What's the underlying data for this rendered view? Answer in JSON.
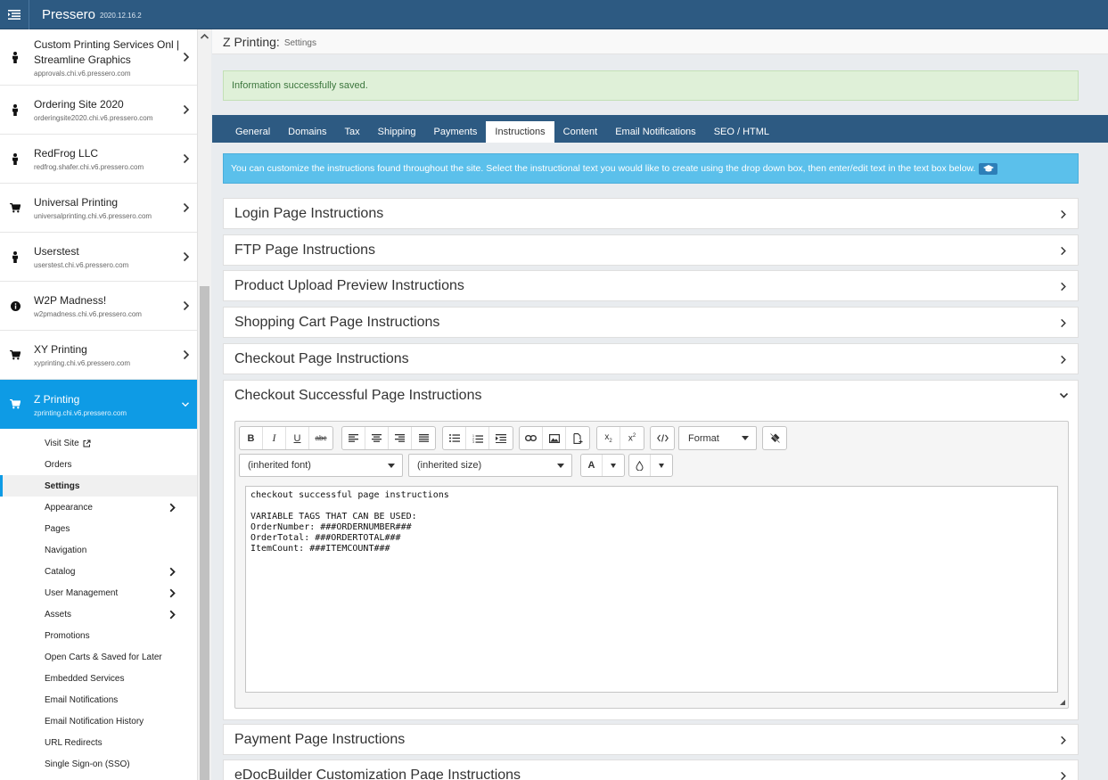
{
  "topbar": {
    "title": "Pressero",
    "version": "2020.12.16.2"
  },
  "sites": [
    {
      "icon": "person-icon",
      "name": "Custom Printing Services Onl | Streamline Graphics",
      "url": "approvals.chi.v6.pressero.com"
    },
    {
      "icon": "person-icon",
      "name": "Ordering Site 2020",
      "url": "orderingsite2020.chi.v6.pressero.com"
    },
    {
      "icon": "person-icon",
      "name": "RedFrog LLC",
      "url": "redfrog.shafer.chi.v6.pressero.com"
    },
    {
      "icon": "cart-icon",
      "name": "Universal Printing",
      "url": "universalprinting.chi.v6.pressero.com"
    },
    {
      "icon": "person-icon",
      "name": "Userstest",
      "url": "userstest.chi.v6.pressero.com"
    },
    {
      "icon": "info-icon",
      "name": "W2P Madness!",
      "url": "w2pmadness.chi.v6.pressero.com"
    },
    {
      "icon": "cart-icon",
      "name": "XY Printing",
      "url": "xyprinting.chi.v6.pressero.com"
    },
    {
      "icon": "cart-icon",
      "name": "Z Printing",
      "url": "zprinting.chi.v6.pressero.com"
    }
  ],
  "subnav": [
    {
      "label": "Visit Site",
      "ext": true
    },
    {
      "label": "Orders"
    },
    {
      "label": "Settings",
      "active": true
    },
    {
      "label": "Appearance",
      "chevron": true
    },
    {
      "label": "Pages"
    },
    {
      "label": "Navigation"
    },
    {
      "label": "Catalog",
      "chevron": true
    },
    {
      "label": "User Management",
      "chevron": true
    },
    {
      "label": "Assets",
      "chevron": true
    },
    {
      "label": "Promotions"
    },
    {
      "label": "Open Carts & Saved for Later"
    },
    {
      "label": "Embedded Services"
    },
    {
      "label": "Email Notifications"
    },
    {
      "label": "Email Notification History"
    },
    {
      "label": "URL Redirects"
    },
    {
      "label": "Single Sign-on (SSO)"
    }
  ],
  "header": {
    "title": "Z Printing:",
    "subtitle": "Settings"
  },
  "alerts": {
    "success": "Information successfully saved.",
    "info": "You can customize the instructions found throughout the site. Select the instructional text you would like to create using the drop down box, then enter/edit text in the text box below."
  },
  "tabs": [
    "General",
    "Domains",
    "Tax",
    "Shipping",
    "Payments",
    "Instructions",
    "Content",
    "Email Notifications",
    "SEO / HTML"
  ],
  "active_tab": "Instructions",
  "panels": [
    "Login Page Instructions",
    "FTP Page Instructions",
    "Product Upload Preview Instructions",
    "Shopping Cart Page Instructions",
    "Checkout Page Instructions",
    "Checkout Successful Page Instructions",
    "Payment Page Instructions",
    "eDocBuilder Customization Page Instructions"
  ],
  "editor": {
    "format_label": "Format",
    "font_select": "(inherited font)",
    "size_select": "(inherited size)",
    "text_color_label": "A",
    "content": [
      "checkout successful page instructions",
      "",
      "VARIABLE TAGS THAT CAN BE USED:",
      "OrderNumber: ###ORDERNUMBER###",
      "OrderTotal: ###ORDERTOTAL###",
      "ItemCount: ###ITEMCOUNT###"
    ]
  },
  "colors": {
    "nav_bar": "#2d5a82",
    "active_site": "#0e9be5",
    "success_bg": "#dff0d8",
    "info_bg": "#5bc0eb"
  }
}
